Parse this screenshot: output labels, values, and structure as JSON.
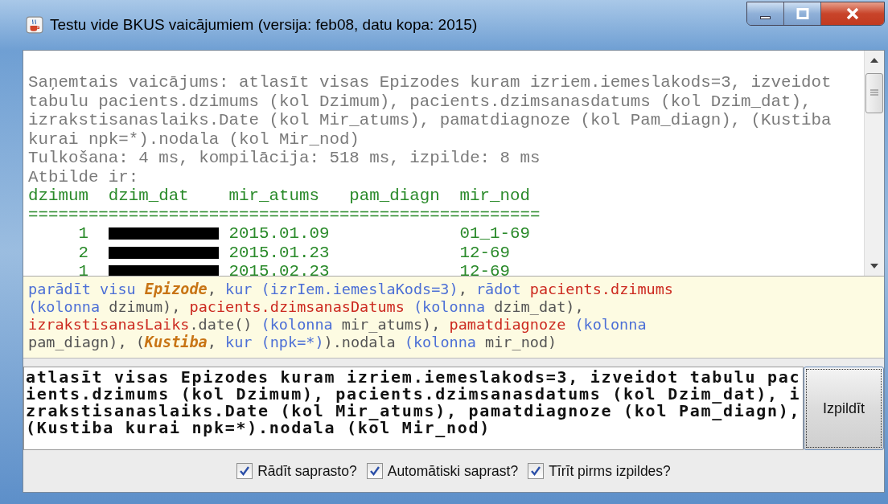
{
  "window": {
    "title": "Testu vide BKUS vaicājumiem (versija: feb08, datu kopa: 2015)"
  },
  "output": {
    "query": "Saņemtais vaicājums: atlasīt visas Epizodes kuram izriem.iemeslakods=3, izveidot tabulu pacients.dzimums (kol Dzimum), pacients.dzimsanasdatums (kol Dzim_dat), izrakstisanaslaiks.Date (kol Mir_atums), pamatdiagnoze (kol Pam_diagn), (Kustiba kurai npk=*).nodala (kol Mir_nod)",
    "timing": "Tulkošana: 4 ms, kompilācija: 518 ms, izpilde: 8 ms",
    "answer_label": "Atbilde ir:",
    "columns": [
      "dzimum",
      "dzim_dat",
      "mir_atums",
      "pam_diagn",
      "mir_nod"
    ],
    "rule": "===================================================",
    "rows": [
      {
        "dzimum": "1",
        "redacted": true,
        "mir_atums": "2015.01.09",
        "mir_nod": "01_1-69"
      },
      {
        "dzimum": "2",
        "redacted": true,
        "mir_atums": "2015.01.23",
        "mir_nod": "12-69"
      },
      {
        "dzimum": "1",
        "redacted": true,
        "mir_atums": "2015.02.23",
        "mir_nod": "12-69"
      }
    ]
  },
  "parsed": [
    {
      "kind": "keyword",
      "text": "parādīt visu "
    },
    {
      "kind": "entity",
      "text": "Epizode"
    },
    {
      "kind": "plain",
      "text": ", "
    },
    {
      "kind": "keyword",
      "text": "kur (izrIem.iemeslaKods=3)"
    },
    {
      "kind": "plain",
      "text": ", "
    },
    {
      "kind": "keyword",
      "text": "rādot "
    },
    {
      "kind": "attribute",
      "text": "pacients.dzimums"
    },
    {
      "kind": "keyword",
      "text": " (kolonna "
    },
    {
      "kind": "plain",
      "text": "dzimum), "
    },
    {
      "kind": "attribute",
      "text": "pacients.dzimsanasDatums"
    },
    {
      "kind": "keyword",
      "text": " (kolonna "
    },
    {
      "kind": "plain",
      "text": "dzim_dat), "
    },
    {
      "kind": "attribute",
      "text": "izrakstisanasLaiks"
    },
    {
      "kind": "plain",
      "text": ".date() "
    },
    {
      "kind": "keyword",
      "text": "(kolonna "
    },
    {
      "kind": "plain",
      "text": "mir_atums), "
    },
    {
      "kind": "attribute",
      "text": "pamatdiagnoze"
    },
    {
      "kind": "keyword",
      "text": " (kolonna "
    },
    {
      "kind": "plain",
      "text": "pam_diagn), ("
    },
    {
      "kind": "entity",
      "text": "Kustiba"
    },
    {
      "kind": "plain",
      "text": ", "
    },
    {
      "kind": "keyword",
      "text": "kur (npk=*)"
    },
    {
      "kind": "plain",
      "text": ").nodala "
    },
    {
      "kind": "keyword",
      "text": "(kolonna "
    },
    {
      "kind": "plain",
      "text": "mir_nod)"
    }
  ],
  "input": {
    "value": "atlasīt visas Epizodes kuram izriem.iemeslakods=3, izveidot tabulu pacients.dzimums (kol Dzimum), pacients.dzimsanasdatums (kol Dzim_dat), izrakstisanaslaiks.Date (kol Mir_atums), pamatdiagnoze (kol Pam_diagn), (Kustiba kurai npk=*).nodala (kol Mir_nod)"
  },
  "run_button": "Izpildīt",
  "options": [
    {
      "label": "Rādīt saprasto?",
      "checked": true
    },
    {
      "label": "Automātiski saprast?",
      "checked": true
    },
    {
      "label": "Tīrīt pirms izpildes?",
      "checked": true
    }
  ]
}
